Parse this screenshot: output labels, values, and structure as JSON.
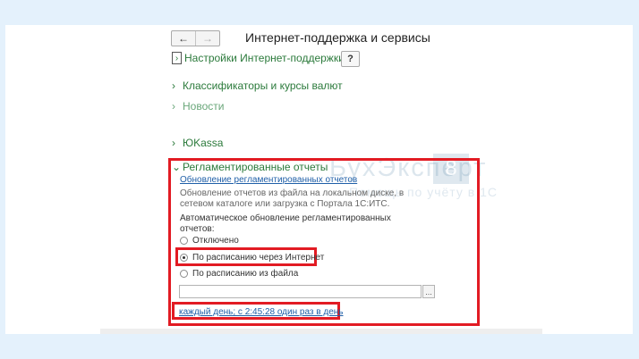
{
  "colors": {
    "page_background": "#e4f1fc",
    "group_text": "#2b7a3b",
    "highlight": "#e21b23",
    "link": "#1f5fa8"
  },
  "toolbar": {
    "back_icon": "←",
    "forward_icon": "→",
    "title": "Интернет-поддержка и сервисы",
    "help_label": "?"
  },
  "groups": {
    "settings": {
      "icon": "›",
      "label": "Настройки Интернет-поддержки"
    },
    "classifiers": {
      "icon": "›",
      "label": "Классификаторы и курсы валют"
    },
    "news": {
      "icon": "›",
      "label": "Новости"
    },
    "yukassa": {
      "icon": "›",
      "label": "ЮKassa"
    },
    "reports": {
      "icon": "⌄",
      "label": "Регламентированные отчеты"
    }
  },
  "watermark": {
    "text": "БухЭксперт",
    "number": "8",
    "sub": "Помощь по учёту в 1С"
  },
  "reports": {
    "update_link": "Обновление регламентированных отчетов",
    "description": "Обновление отчетов из файла на локальном диске, в сетевом каталоге или загрузка с Портала 1С:ИТС.",
    "auto_update_label": "Автоматическое обновление регламентированных отчетов:",
    "options": [
      {
        "label": "Отключено",
        "selected": false
      },
      {
        "label": "По расписанию через Интернет",
        "selected": true
      },
      {
        "label": "По расписанию из файла",
        "selected": false
      }
    ],
    "file_path_value": "",
    "file_browse_label": "...",
    "schedule_link": "каждый день; с 2:45:28 один раз в день"
  }
}
